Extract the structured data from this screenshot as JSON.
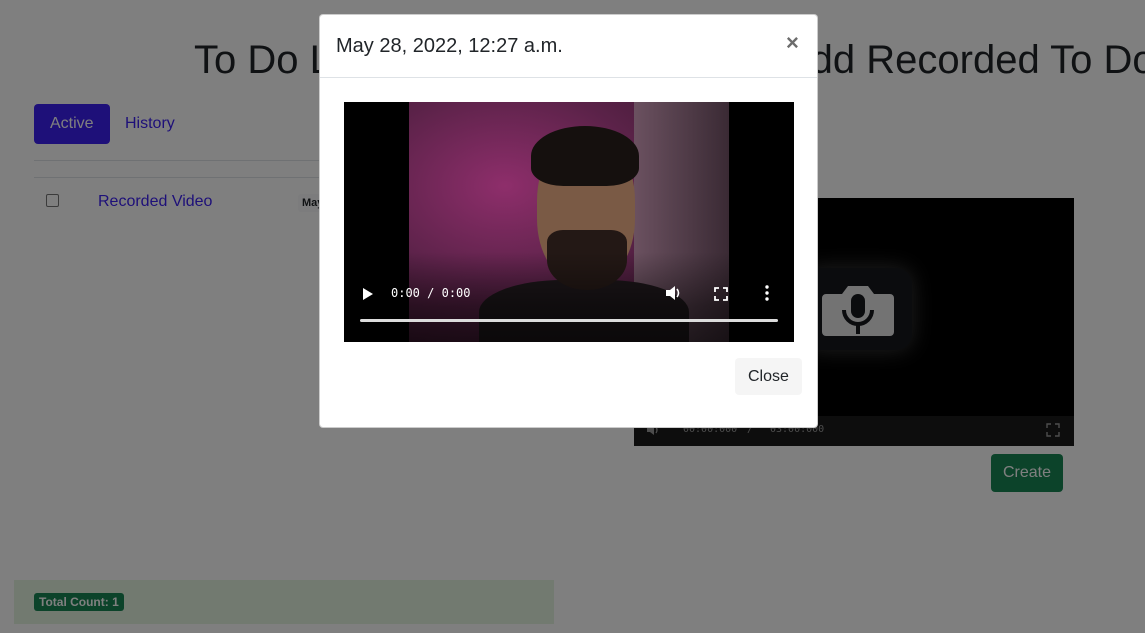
{
  "left_panel": {
    "title": "To Do List",
    "tabs": [
      {
        "label": "Active"
      },
      {
        "label": "History"
      }
    ],
    "rows": [
      {
        "title": "Recorded Video",
        "date_badge": "May 28, 2022, 12:27 a.m."
      }
    ],
    "total_count": "Total Count: 1"
  },
  "right_panel": {
    "title": "Add Recorded To Do",
    "recorder": {
      "current_time": "00:00:000",
      "separator": "/",
      "total_time": "03:00:000",
      "icon": "camera-mic-icon"
    },
    "create_label": "Create"
  },
  "modal": {
    "title": "May 28, 2022, 12:27 a.m.",
    "close_x": "×",
    "video": {
      "current_time": "0:00",
      "separator": "/",
      "duration": "0:00",
      "progress": 0
    },
    "close_label": "Close"
  },
  "colors": {
    "primary": "#3d21f2",
    "success": "#198754",
    "backdrop": "rgba(0,0,0,0.5)"
  }
}
